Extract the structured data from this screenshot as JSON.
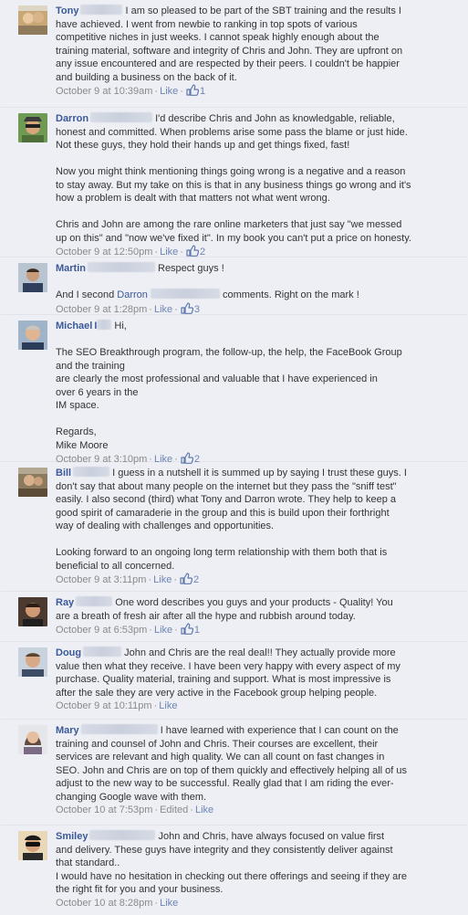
{
  "comments": [
    {
      "author": "Tony",
      "lines": [
        "I am so pleased to be part of the SBT training and the results I",
        "have achieved. I went from newbie to ranking in top spots of various",
        "competitive niches in just weeks. I cannot speak highly enough about the",
        "training material, software and integrity of Chris and John. They are upfront on",
        "any issue encountered and are respected by their peers. I couldn't be happier",
        "and building a business on the back of it."
      ],
      "timestamp": "October 9 at 10:39am",
      "like_label": "Like",
      "like_count": "1"
    },
    {
      "author": "Darron",
      "lines": [
        "I'd describe Chris and John as knowledgable, reliable,",
        "honest and committed. When problems arise some pass the blame or just hide.",
        "Not these guys, they hold their hands up and get things fixed, fast!"
      ],
      "para2": [
        "Now you might think mentioning things going wrong is a negative and a reason",
        "to stay away. But my take on this is that in any business things go wrong and it's",
        "how a problem is dealt with that matters not what went wrong."
      ],
      "para3": [
        "Chris and John are among the rare online marketers that just say \"we messed",
        "up on this\" and \"now we've fixed it\". In my book you can't put a price on honesty."
      ],
      "timestamp": "October 9 at 12:50pm",
      "like_label": "Like",
      "like_count": "2"
    },
    {
      "author": "Martin",
      "lines": [
        "Respect guys !"
      ],
      "para2_prefix": "And I second",
      "para2_mention": "Darron",
      "para2_suffix": "comments. Right on the mark !",
      "timestamp": "October 9 at 1:28pm",
      "like_label": "Like",
      "like_count": "3"
    },
    {
      "author": "Michael",
      "author_suffix": "I",
      "lines": [
        "Hi,"
      ],
      "para2": [
        "The SEO Breakthrough program, the follow-up, the help, the FaceBook Group",
        "and the training",
        "are clearly the most professional and valuable that I have experienced in",
        "over 6 years in the",
        "IM space."
      ],
      "para3": [
        "Regards,",
        "Mike Moore"
      ],
      "timestamp": "October 9 at 3:10pm",
      "like_label": "Like",
      "like_count": "2"
    },
    {
      "author": "Bill",
      "lines": [
        "I guess in a nutshell it is summed up by saying I trust these guys. I",
        "don't say that about many people on the internet but they pass the \"sniff test\"",
        "easily. I also second (third) what Tony and Darron wrote. They help to keep a",
        "good spirit of camaraderie in the group and this is build upon their forthright",
        "way of dealing with challenges and opportunities."
      ],
      "para2": [
        "Looking forward to an ongoing long term relationship with them both that is",
        "beneficial to all concerned."
      ],
      "timestamp": "October 9 at 3:11pm",
      "like_label": "Like",
      "like_count": "2"
    },
    {
      "author": "Ray",
      "lines": [
        "One word describes you guys and your products - Quality! You",
        "are a breath of fresh air after all the hype and rubbish around today."
      ],
      "timestamp": "October 9 at 6:53pm",
      "like_label": "Like",
      "like_count": "1"
    },
    {
      "author": "Doug",
      "lines": [
        "John and Chris are the real deal!! They actually provide more",
        "value then what they receive. I have been very happy with every aspect of my",
        "purchase. Quality material, training and support. What is most impressive is",
        "after the sale they are very active in the Facebook group helping people."
      ],
      "timestamp": "October 9 at 10:11pm",
      "like_label": "Like"
    },
    {
      "author": "Mary",
      "lines": [
        "I have learned with experience that I can count on the",
        "training and counsel of John and Chris. Their courses are excellent, their",
        "services are relevant and high quality. We can all count on fast changes in",
        "SEO. John and Chris are on top of them quickly and effectively helping all of us",
        "adjust to the new way to be successful. Really glad that I am riding the ever-",
        "changing Google wave with them."
      ],
      "timestamp": "October 10 at 7:53pm",
      "edited_label": "Edited",
      "like_label": "Like"
    },
    {
      "author": "Smiley",
      "lines": [
        "John and Chris, have always focused on value first",
        "and delivery. These guys have integrity and they consistently deliver against",
        "that standard..",
        "I would have no hesitation in checking out there offerings and seeing if they are",
        "the right fit for you and your business."
      ],
      "timestamp": "October 10 at 8:28pm",
      "like_label": "Like"
    }
  ],
  "colors": {
    "background": "#edeff4",
    "author_link": "#3b5998",
    "meta_text": "#8a8a8a",
    "like_link": "#6d84b4"
  },
  "icons": {
    "like_count": "thumbs-up-icon",
    "avatar": "avatar-photo"
  }
}
